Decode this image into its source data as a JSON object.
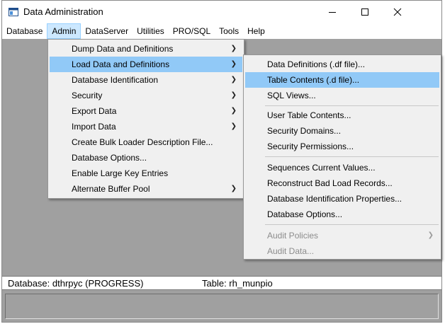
{
  "window": {
    "title": "Data Administration"
  },
  "menubar": [
    {
      "label": "Database",
      "active": false
    },
    {
      "label": "Admin",
      "active": true
    },
    {
      "label": "DataServer",
      "active": false
    },
    {
      "label": "Utilities",
      "active": false
    },
    {
      "label": "PRO/SQL",
      "active": false
    },
    {
      "label": "Tools",
      "active": false
    },
    {
      "label": "Help",
      "active": false
    }
  ],
  "admin_menu": [
    {
      "label": "Dump Data and Definitions",
      "submenu": true
    },
    {
      "label": "Load Data and Definitions",
      "submenu": true,
      "highlighted": true
    },
    {
      "label": "Database Identification",
      "submenu": true
    },
    {
      "label": "Security",
      "submenu": true
    },
    {
      "label": "Export Data",
      "submenu": true
    },
    {
      "label": "Import Data",
      "submenu": true
    },
    {
      "label": "Create Bulk Loader Description File...",
      "submenu": false
    },
    {
      "label": "Database Options...",
      "submenu": false
    },
    {
      "label": "Enable Large Key Entries",
      "submenu": false
    },
    {
      "label": "Alternate Buffer Pool",
      "submenu": true
    }
  ],
  "load_submenu": [
    {
      "label": "Data Definitions (.df file)..."
    },
    {
      "label": "Table Contents (.d file)...",
      "highlighted": true
    },
    {
      "label": "SQL Views..."
    },
    {
      "separator": true
    },
    {
      "label": "User Table Contents..."
    },
    {
      "label": "Security Domains..."
    },
    {
      "label": "Security Permissions..."
    },
    {
      "separator": true
    },
    {
      "label": "Sequences Current Values..."
    },
    {
      "label": "Reconstruct Bad Load Records..."
    },
    {
      "label": "Database Identification Properties..."
    },
    {
      "label": "Database Options..."
    },
    {
      "separator": true
    },
    {
      "label": "Audit Policies",
      "submenu": true,
      "disabled": true
    },
    {
      "label": "Audit Data...",
      "disabled": true
    }
  ],
  "status": {
    "database": "Database: dthrpyc (PROGRESS)",
    "table": "Table: rh_munpio"
  },
  "colors": {
    "highlight": "#91c9f7",
    "menubar_active": "#cce8ff",
    "workspace": "#a0a0a0",
    "menu_bg": "#f0f0f0"
  },
  "icons": {
    "app": "window-app-icon",
    "minimize": "minimize-icon",
    "maximize": "maximize-icon",
    "close": "close-icon",
    "submenu_arrow": "chevron-right-icon"
  }
}
